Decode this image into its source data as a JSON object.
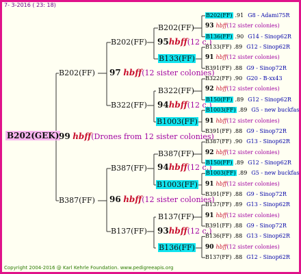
{
  "header": {
    "date": "7-  3-2016 ( 23: 18)"
  },
  "footer": {
    "copyright": "Copyright 2004-2016 @ Karl Kehrle Foundation.   www.pedigreeapis.org"
  },
  "root": {
    "label": "B202(GEK)",
    "num": "99",
    "hbff": "hbff",
    "note": "(Drones from 12 sister colonies)"
  },
  "level1": [
    {
      "label": "B202(FF)",
      "num": "97",
      "hbff": "hbff",
      "note": "(12 sister colonies)"
    },
    {
      "label": "B387(FF)",
      "num": "96",
      "hbff": "hbff",
      "note": "(12 sister colonies)"
    }
  ],
  "level2": [
    {
      "label": "B202(FF)",
      "num": "95",
      "hbff": "hbff",
      "note": "(12 c.)"
    },
    {
      "label": "B322(FF)",
      "num": "94",
      "hbff": "hbff",
      "note": "(12 c.)"
    },
    {
      "label": "B387(FF)",
      "num": "94",
      "hbff": "hbff",
      "note": "(12 c.)"
    },
    {
      "label": "B137(FF)",
      "num": "93",
      "hbff": "hbff",
      "note": "(12 c.)"
    }
  ],
  "level3": [
    {
      "label": "B202(FF)",
      "highlight": false
    },
    {
      "label": "B133(FF)",
      "highlight": true
    },
    {
      "label": "B322(FF)",
      "highlight": false
    },
    {
      "label": "B1003(FF)",
      "highlight": true
    },
    {
      "label": "B387(FF)",
      "highlight": false
    },
    {
      "label": "B1003(FF)",
      "highlight": true
    },
    {
      "label": "B137(FF)",
      "highlight": false
    },
    {
      "label": "B136(FF)",
      "highlight": true
    }
  ],
  "leaves": [
    {
      "name": "B202(FF)",
      "score": ".91",
      "code": "G8 - Adami75R",
      "hl": true
    },
    {
      "num": "93",
      "hbff": "hbff",
      "note": "(12 sister colonies)"
    },
    {
      "name": "B136(FF)",
      "score": ".90",
      "code": "G14 - Sinop62R",
      "hl": true
    },
    {
      "name": "B133(FF)",
      "score": ".89",
      "code": "G12 - Sinop62R",
      "hl": false
    },
    {
      "num": "91",
      "hbff": "hbff",
      "note": "(12 sister colonies)"
    },
    {
      "name": "B391(FF)",
      "score": ".88",
      "code": "G9 - Sinop72R",
      "hl": false
    },
    {
      "name": "B322(FF)",
      "score": ".90",
      "code": "G20 - B-xx43",
      "hl": false
    },
    {
      "num": "92",
      "hbff": "hbff",
      "note": "(12 sister colonies)"
    },
    {
      "name": "B150(FF)",
      "score": ".89",
      "code": "G12 - Sinop62R",
      "hl": true
    },
    {
      "name": "B1003(FF)",
      "score": ".89",
      "code": "G5 - new buckfas",
      "hl": true
    },
    {
      "num": "91",
      "hbff": "hbff",
      "note": "(12 sister colonies)"
    },
    {
      "name": "B391(FF)",
      "score": ".88",
      "code": "G9 - Sinop72R",
      "hl": false
    },
    {
      "name": "B387(FF)",
      "score": ".90",
      "code": "G13 - Sinop62R",
      "hl": false
    },
    {
      "num": "92",
      "hbff": "hbff",
      "note": "(12 sister colonies)"
    },
    {
      "name": "B150(FF)",
      "score": ".89",
      "code": "G12 - Sinop62R",
      "hl": true
    },
    {
      "name": "B1003(FF)",
      "score": ".89",
      "code": "G5 - new buckfas",
      "hl": true
    },
    {
      "num": "91",
      "hbff": "hbff",
      "note": "(12 sister colonies)"
    },
    {
      "name": "B391(FF)",
      "score": ".88",
      "code": "G9 - Sinop72R",
      "hl": false
    },
    {
      "name": "B137(FF)",
      "score": ".89",
      "code": "G13 - Sinop62R",
      "hl": false
    },
    {
      "num": "91",
      "hbff": "hbff",
      "note": "(12 sister colonies)"
    },
    {
      "name": "B391(FF)",
      "score": ".88",
      "code": "G9 - Sinop72R",
      "hl": false
    },
    {
      "name": "B136(FF)",
      "score": ".88",
      "code": "G13 - Sinop62R",
      "hl": false
    },
    {
      "num": "90",
      "hbff": "hbff",
      "note": "(12 sister colonies)"
    },
    {
      "name": "B137(FF)",
      "score": ".88",
      "code": "G12 - Sinop62R",
      "hl": false
    }
  ],
  "colors": {
    "frame": "#e0128a",
    "highlight": "#10e4ef",
    "root_bg": "#f8b6f0",
    "hbff": "#c8102e"
  }
}
